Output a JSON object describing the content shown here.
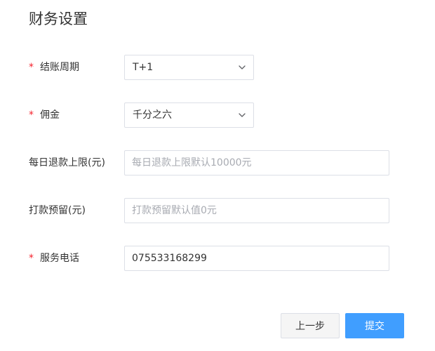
{
  "page": {
    "title": "财务设置"
  },
  "form": {
    "required_mark": "*",
    "settlement_cycle": {
      "label": "结账周期",
      "value": "T+1"
    },
    "commission": {
      "label": "佣金",
      "value": "千分之六"
    },
    "daily_refund_limit": {
      "label": "每日退款上限(元)",
      "value": "",
      "placeholder": "每日退款上限默认10000元"
    },
    "payment_reserve": {
      "label": "打款预留(元)",
      "value": "",
      "placeholder": "打款预留默认值0元"
    },
    "service_phone": {
      "label": "服务电话",
      "value": "075533168299",
      "placeholder": ""
    }
  },
  "actions": {
    "prev_label": "上一步",
    "submit_label": "提交"
  },
  "colors": {
    "primary": "#409eff",
    "required": "#f5222d",
    "border": "#dcdfe6",
    "text": "#333333",
    "placeholder": "#a8abb2"
  },
  "icons": {
    "select_arrow": "chevron-down-icon"
  }
}
